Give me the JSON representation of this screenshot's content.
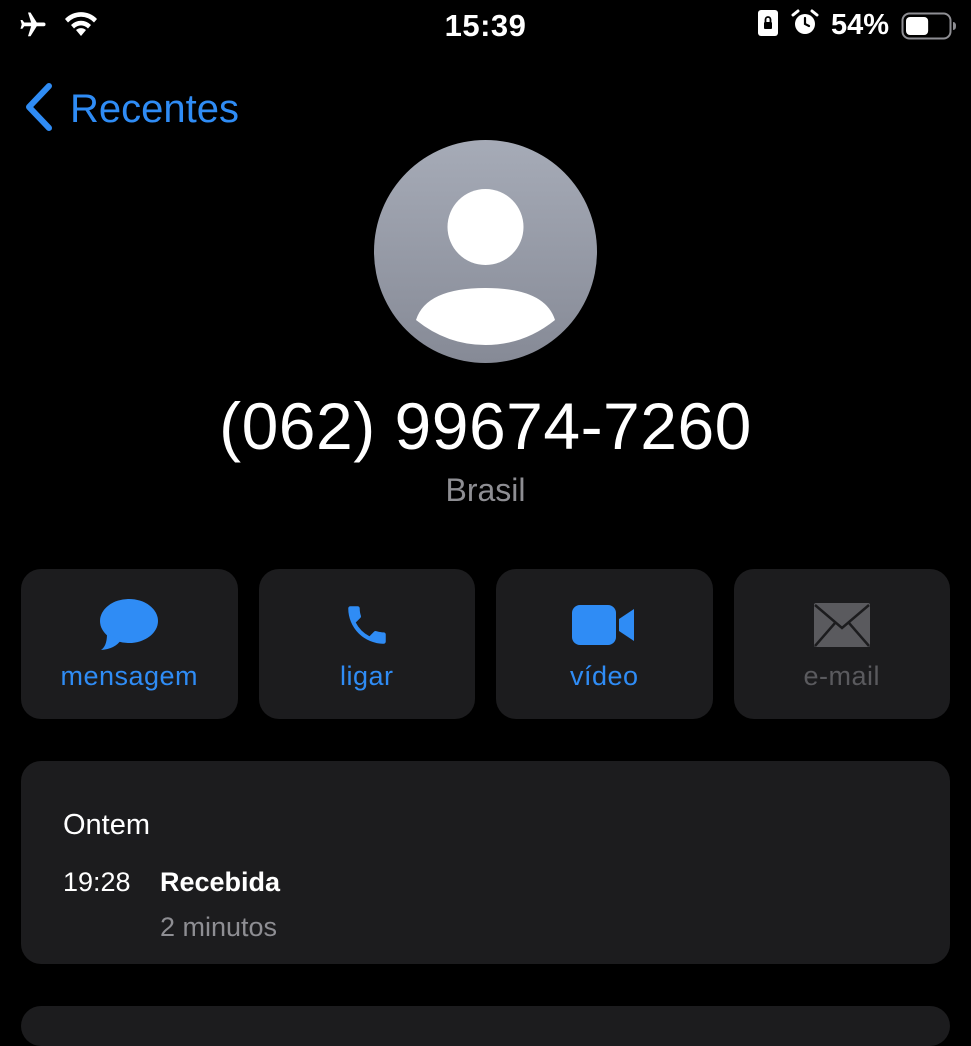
{
  "status_bar": {
    "time": "15:39",
    "battery_percent": "54%",
    "battery_level": 0.54,
    "icons": [
      "airplane-icon",
      "wifi-icon",
      "portrait-lock-icon",
      "alarm-icon",
      "battery-icon"
    ]
  },
  "nav": {
    "back_label": "Recentes",
    "back_icon": "chevron-left-icon"
  },
  "contact": {
    "avatar_icon": "person-silhouette-icon",
    "phone_number": "(062) 99674-7260",
    "country": "Brasil"
  },
  "actions": [
    {
      "label": "mensagem",
      "icon": "message-bubble-icon",
      "enabled": true
    },
    {
      "label": "ligar",
      "icon": "phone-icon",
      "enabled": true
    },
    {
      "label": "vídeo",
      "icon": "video-camera-icon",
      "enabled": true
    },
    {
      "label": "e-mail",
      "icon": "envelope-icon",
      "enabled": false
    }
  ],
  "history": {
    "date": "Ontem",
    "time": "19:28",
    "type": "Recebida",
    "duration": "2 minutos"
  },
  "colors": {
    "accent": "#2f8cf5",
    "background": "#000000",
    "card": "#1c1c1e",
    "secondary_text": "#8e8e93",
    "disabled": "#5a5a5e"
  }
}
